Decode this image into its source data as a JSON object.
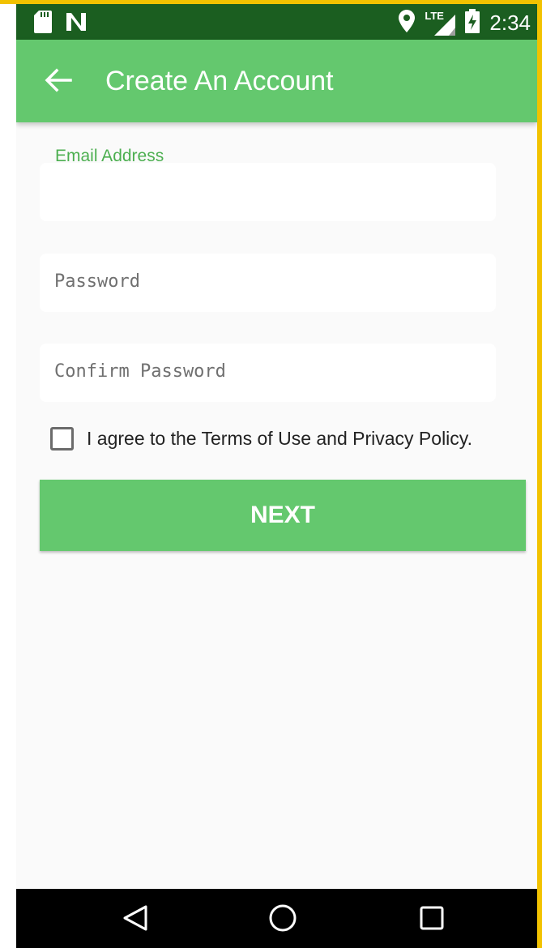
{
  "status_bar": {
    "time": "2:34",
    "network_label": "LTE",
    "icons": [
      "sd-card-icon",
      "notification-n-icon",
      "location-icon",
      "lte-signal-icon",
      "battery-charging-icon"
    ]
  },
  "app_bar": {
    "title": "Create An Account",
    "back_icon": "arrow-back-icon"
  },
  "form": {
    "email": {
      "label": "Email Address",
      "value": ""
    },
    "password": {
      "placeholder": "Password",
      "value": ""
    },
    "confirm_password": {
      "placeholder": "Confirm Password",
      "value": ""
    },
    "agree": {
      "label": "I agree to the Terms of Use and Privacy Policy.",
      "checked": false
    },
    "next_label": "NEXT"
  },
  "nav_bar": {
    "icons": [
      "back-triangle-icon",
      "home-circle-icon",
      "recents-square-icon"
    ]
  },
  "colors": {
    "app_bar": "#64c86e",
    "status_bar": "#1b5e20",
    "accent": "#4caf50",
    "background": "#fafafa",
    "frame": "#f2c200"
  }
}
